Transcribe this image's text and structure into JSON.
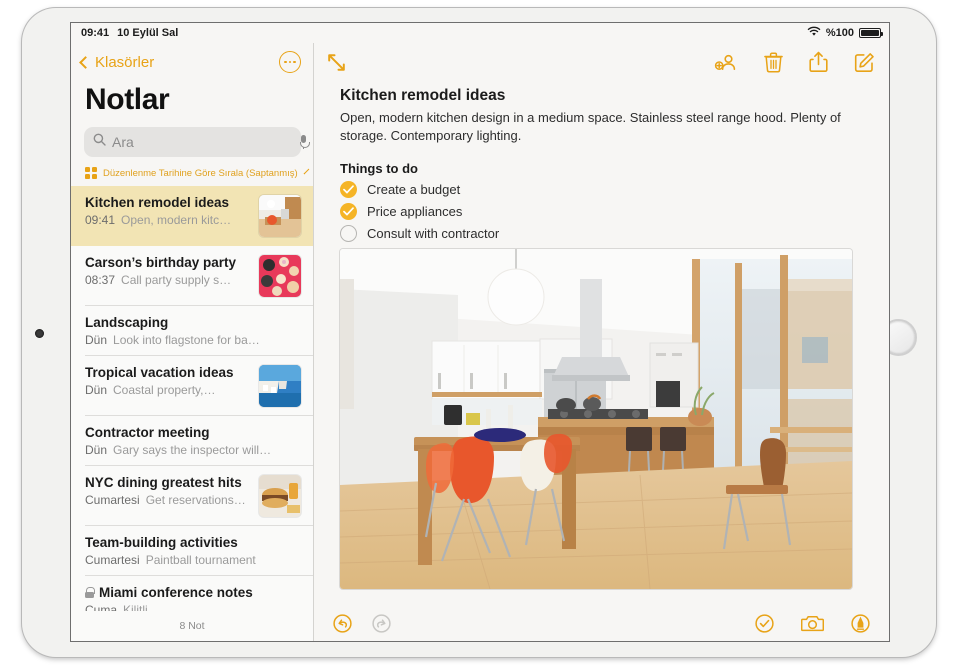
{
  "status_bar": {
    "time": "09:41",
    "date": "10 Eylül Sal",
    "wifi_icon": "wifi-icon",
    "battery_percent": "%100",
    "battery_icon": "battery-icon"
  },
  "colors": {
    "accent": "#e8a317",
    "selected_row": "#f2e4b4",
    "checkbox_filled": "#f5b426",
    "sidebar_bg": "#fafaf9",
    "disabled": "#c8c7c4"
  },
  "sidebar": {
    "back_label": "Klasörler",
    "back_icon": "chevron-left-icon",
    "more_icon": "more-ellipsis-icon",
    "title": "Notlar",
    "search": {
      "placeholder": "Ara",
      "value": "",
      "search_icon": "search-icon",
      "mic_icon": "microphone-icon"
    },
    "sort": {
      "label": "Düzenlenme Tarihine Göre Sırala (Saptanmış)",
      "grid_icon": "grid-view-icon",
      "chevron_icon": "chevron-down-icon"
    },
    "notes": [
      {
        "title": "Kitchen remodel ideas",
        "time": "09:41",
        "preview": "Open, modern kitc…",
        "selected": true,
        "thumbnail": "kitchen-thumbnail",
        "locked": false
      },
      {
        "title": "Carson’s birthday party",
        "time": "08:37",
        "preview": "Call party supply s…",
        "selected": false,
        "thumbnail": "cupcakes-thumbnail",
        "locked": false
      },
      {
        "title": "Landscaping",
        "time": "Dün",
        "preview": "Look into flagstone for ba…",
        "selected": false,
        "thumbnail": null,
        "locked": false
      },
      {
        "title": "Tropical vacation ideas",
        "time": "Dün",
        "preview": "Coastal property,…",
        "selected": false,
        "thumbnail": "coastal-thumbnail",
        "locked": false
      },
      {
        "title": "Contractor meeting",
        "time": "Dün",
        "preview": "Gary says the inspector will…",
        "selected": false,
        "thumbnail": null,
        "locked": false
      },
      {
        "title": "NYC dining greatest hits",
        "time": "Cumartesi",
        "preview": "Get reservations…",
        "selected": false,
        "thumbnail": "burger-thumbnail",
        "locked": false
      },
      {
        "title": "Team-building activities",
        "time": "Cumartesi",
        "preview": "Paintball tournament",
        "selected": false,
        "thumbnail": null,
        "locked": false
      },
      {
        "title": "Miami conference notes",
        "time": "Cuma",
        "preview": "Kilitli",
        "selected": false,
        "thumbnail": null,
        "locked": true
      }
    ],
    "footer_count": "8 Not"
  },
  "detail": {
    "toolbar": {
      "expand_icon": "expand-diagonal-icon",
      "add_person_icon": "add-person-icon",
      "delete_icon": "trash-icon",
      "share_icon": "share-icon",
      "compose_icon": "compose-icon"
    },
    "note": {
      "heading": "Kitchen remodel ideas",
      "body": "Open, modern kitchen design in a medium space. Stainless steel range hood. Plenty of storage. Contemporary lighting.",
      "todo_heading": "Things to do",
      "todos": [
        {
          "label": "Create a budget",
          "checked": true
        },
        {
          "label": "Price appliances",
          "checked": true
        },
        {
          "label": "Consult with contractor",
          "checked": false
        }
      ],
      "photo_name": "kitchen-dining-room-photo"
    },
    "footer": {
      "undo_icon": "undo-icon",
      "undo_enabled": true,
      "redo_icon": "redo-icon",
      "redo_enabled": false,
      "checklist_icon": "checklist-icon",
      "camera_icon": "camera-icon",
      "markup_icon": "markup-pen-icon"
    }
  },
  "device": {
    "home_button": "home-button",
    "front_camera": "front-camera"
  }
}
